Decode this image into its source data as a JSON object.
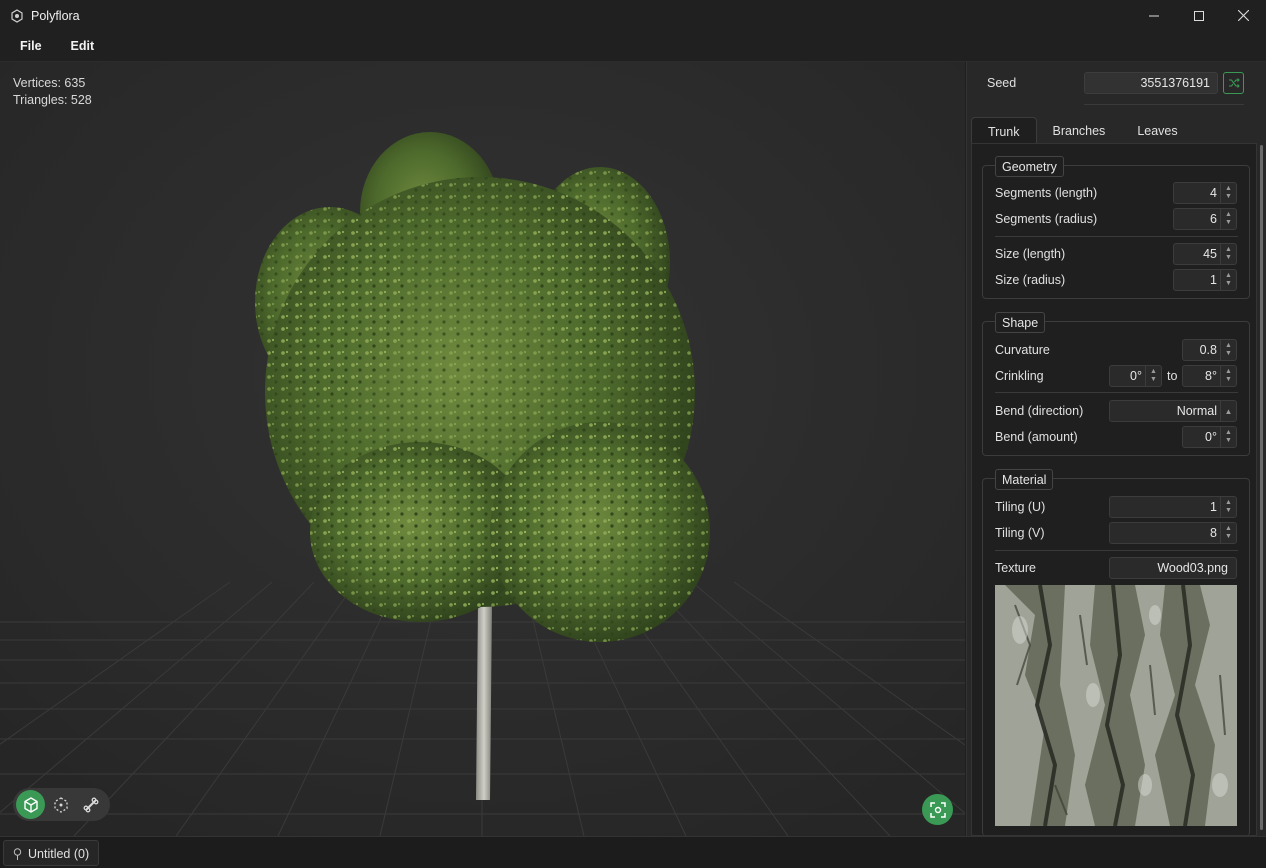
{
  "window": {
    "title": "Polyflora",
    "controls": [
      "minimize",
      "maximize",
      "close"
    ]
  },
  "menu": {
    "file": "File",
    "edit": "Edit"
  },
  "viewport": {
    "vertices": "Vertices: 635",
    "triangles": "Triangles: 528",
    "tools": [
      "cube-view-icon",
      "selection-icon",
      "bone-icon"
    ],
    "active_tool": "cube-view-icon"
  },
  "panel": {
    "seed_label": "Seed",
    "seed_value": "3551376191",
    "tabs": [
      "Trunk",
      "Branches",
      "Leaves"
    ],
    "active_tab": "Trunk",
    "geometry": {
      "title": "Geometry",
      "segments_length_label": "Segments (length)",
      "segments_length": "4",
      "segments_radius_label": "Segments (radius)",
      "segments_radius": "6",
      "size_length_label": "Size (length)",
      "size_length": "45",
      "size_radius_label": "Size (radius)",
      "size_radius": "1"
    },
    "shape": {
      "title": "Shape",
      "curvature_label": "Curvature",
      "curvature": "0.8",
      "crinkling_label": "Crinkling",
      "crinkling_min": "0°",
      "crinkling_to": "to",
      "crinkling_max": "8°",
      "bend_direction_label": "Bend (direction)",
      "bend_direction": "Normal",
      "bend_amount_label": "Bend (amount)",
      "bend_amount": "0°"
    },
    "material": {
      "title": "Material",
      "tiling_u_label": "Tiling (U)",
      "tiling_u": "1",
      "tiling_v_label": "Tiling (V)",
      "tiling_v": "8",
      "texture_label": "Texture",
      "texture": "Wood03.png"
    }
  },
  "status": {
    "document": "Untitled (0)"
  },
  "colors": {
    "accent": "#3a9a55",
    "background": "#1f1f1f",
    "viewport": "#2d2d2d"
  }
}
